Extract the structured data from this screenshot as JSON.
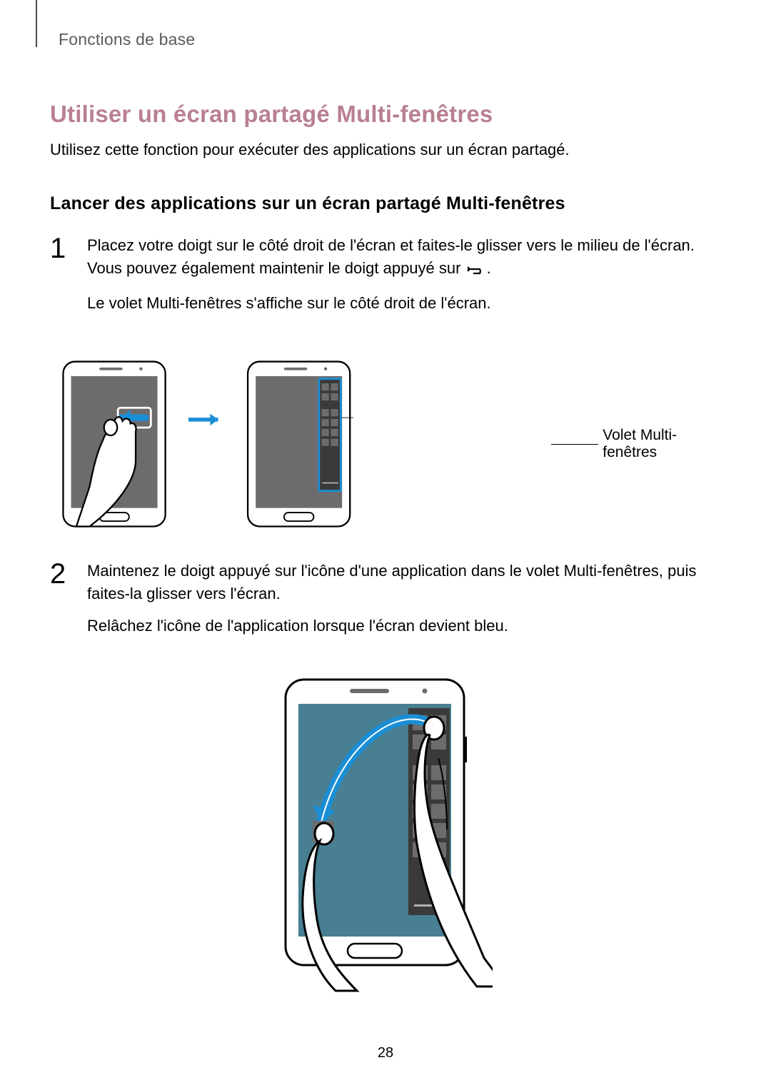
{
  "header": {
    "breadcrumb": "Fonctions de base"
  },
  "title": "Utiliser un écran partagé Multi-fenêtres",
  "lead": "Utilisez cette fonction pour exécuter des applications sur un écran partagé.",
  "subheading": "Lancer des applications sur un écran partagé Multi-fenêtres",
  "steps": [
    {
      "num": "1",
      "text1_a": "Placez votre doigt sur le côté droit de l'écran et faites-le glisser vers le milieu de l'écran. Vous pouvez également maintenir le doigt appuyé sur ",
      "text1_b": ".",
      "text2": "Le volet Multi-fenêtres s'affiche sur le côté droit de l'écran."
    },
    {
      "num": "2",
      "text1": "Maintenez le doigt appuyé sur l'icône d'une application dans le volet Multi-fenêtres, puis faites-la glisser vers l'écran.",
      "text2": "Relâchez l'icône de l'application lorsque l'écran devient bleu."
    }
  ],
  "callout": "Volet Multi-fenêtres",
  "page_number": "28"
}
